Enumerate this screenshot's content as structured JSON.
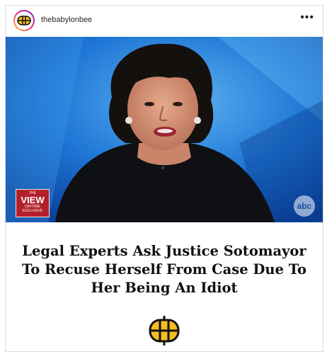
{
  "post": {
    "username": "thebabylonbee",
    "more_icon": "more-options-icon",
    "photo": {
      "show_logo_line1": "THE",
      "show_logo_line2": "VIEW",
      "show_logo_line3": "DAYTIME",
      "show_logo_line4": "EXCLUSIVE",
      "network_logo": "abc"
    },
    "headline": "Legal Experts Ask Justice Sotomayor To Recuse Herself From Case Due To Her Being An Idiot"
  },
  "colors": {
    "background_blue": "#1e76d6",
    "view_badge": "#b3202a",
    "logo_yellow": "#f5bd20",
    "text_dark": "#111111"
  }
}
